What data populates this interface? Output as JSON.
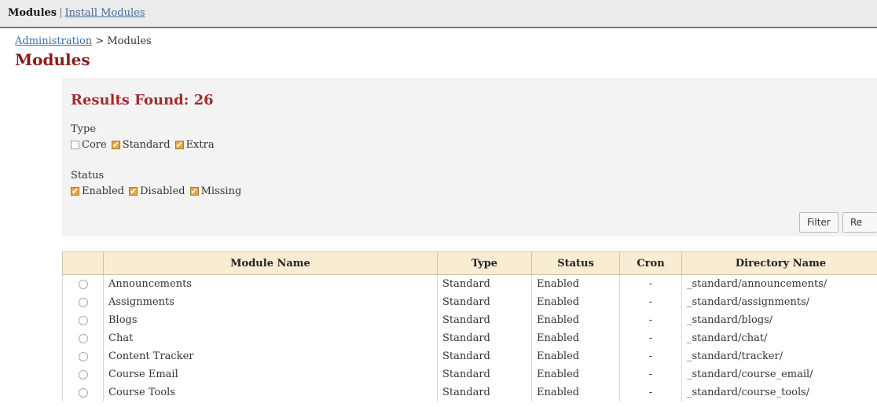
{
  "topbar": {
    "current": "Modules",
    "separator": "|",
    "install_link": "Install Modules"
  },
  "breadcrumb": {
    "admin_link": "Administration",
    "separator": ">",
    "current": "Modules"
  },
  "page_title": "Modules",
  "filter": {
    "results_label": "Results Found: 26",
    "type": {
      "label": "Type",
      "options": [
        {
          "label": "Core",
          "checked": false
        },
        {
          "label": "Standard",
          "checked": true
        },
        {
          "label": "Extra",
          "checked": true
        }
      ]
    },
    "status": {
      "label": "Status",
      "options": [
        {
          "label": "Enabled",
          "checked": true
        },
        {
          "label": "Disabled",
          "checked": true
        },
        {
          "label": "Missing",
          "checked": true
        }
      ]
    },
    "filter_button": "Filter",
    "reset_button": "Re"
  },
  "table": {
    "headers": [
      "",
      "Module Name",
      "Type",
      "Status",
      "Cron",
      "Directory Name"
    ],
    "rows": [
      {
        "name": "Announcements",
        "type": "Standard",
        "status": "Enabled",
        "cron": "-",
        "directory": "_standard/announcements/"
      },
      {
        "name": "Assignments",
        "type": "Standard",
        "status": "Enabled",
        "cron": "-",
        "directory": "_standard/assignments/"
      },
      {
        "name": "Blogs",
        "type": "Standard",
        "status": "Enabled",
        "cron": "-",
        "directory": "_standard/blogs/"
      },
      {
        "name": "Chat",
        "type": "Standard",
        "status": "Enabled",
        "cron": "-",
        "directory": "_standard/chat/"
      },
      {
        "name": "Content Tracker",
        "type": "Standard",
        "status": "Enabled",
        "cron": "-",
        "directory": "_standard/tracker/"
      },
      {
        "name": "Course Email",
        "type": "Standard",
        "status": "Enabled",
        "cron": "-",
        "directory": "_standard/course_email/"
      },
      {
        "name": "Course Tools",
        "type": "Standard",
        "status": "Enabled",
        "cron": "-",
        "directory": "_standard/course_tools/"
      }
    ]
  },
  "colors": {
    "title_red": "#8b1a1a",
    "results_red": "#a52a2a",
    "link_blue": "#3a6ea5",
    "checkbox_orange": "#e3a845",
    "header_bg": "#f8ecd3",
    "panel_bg": "#f3f3f3"
  }
}
